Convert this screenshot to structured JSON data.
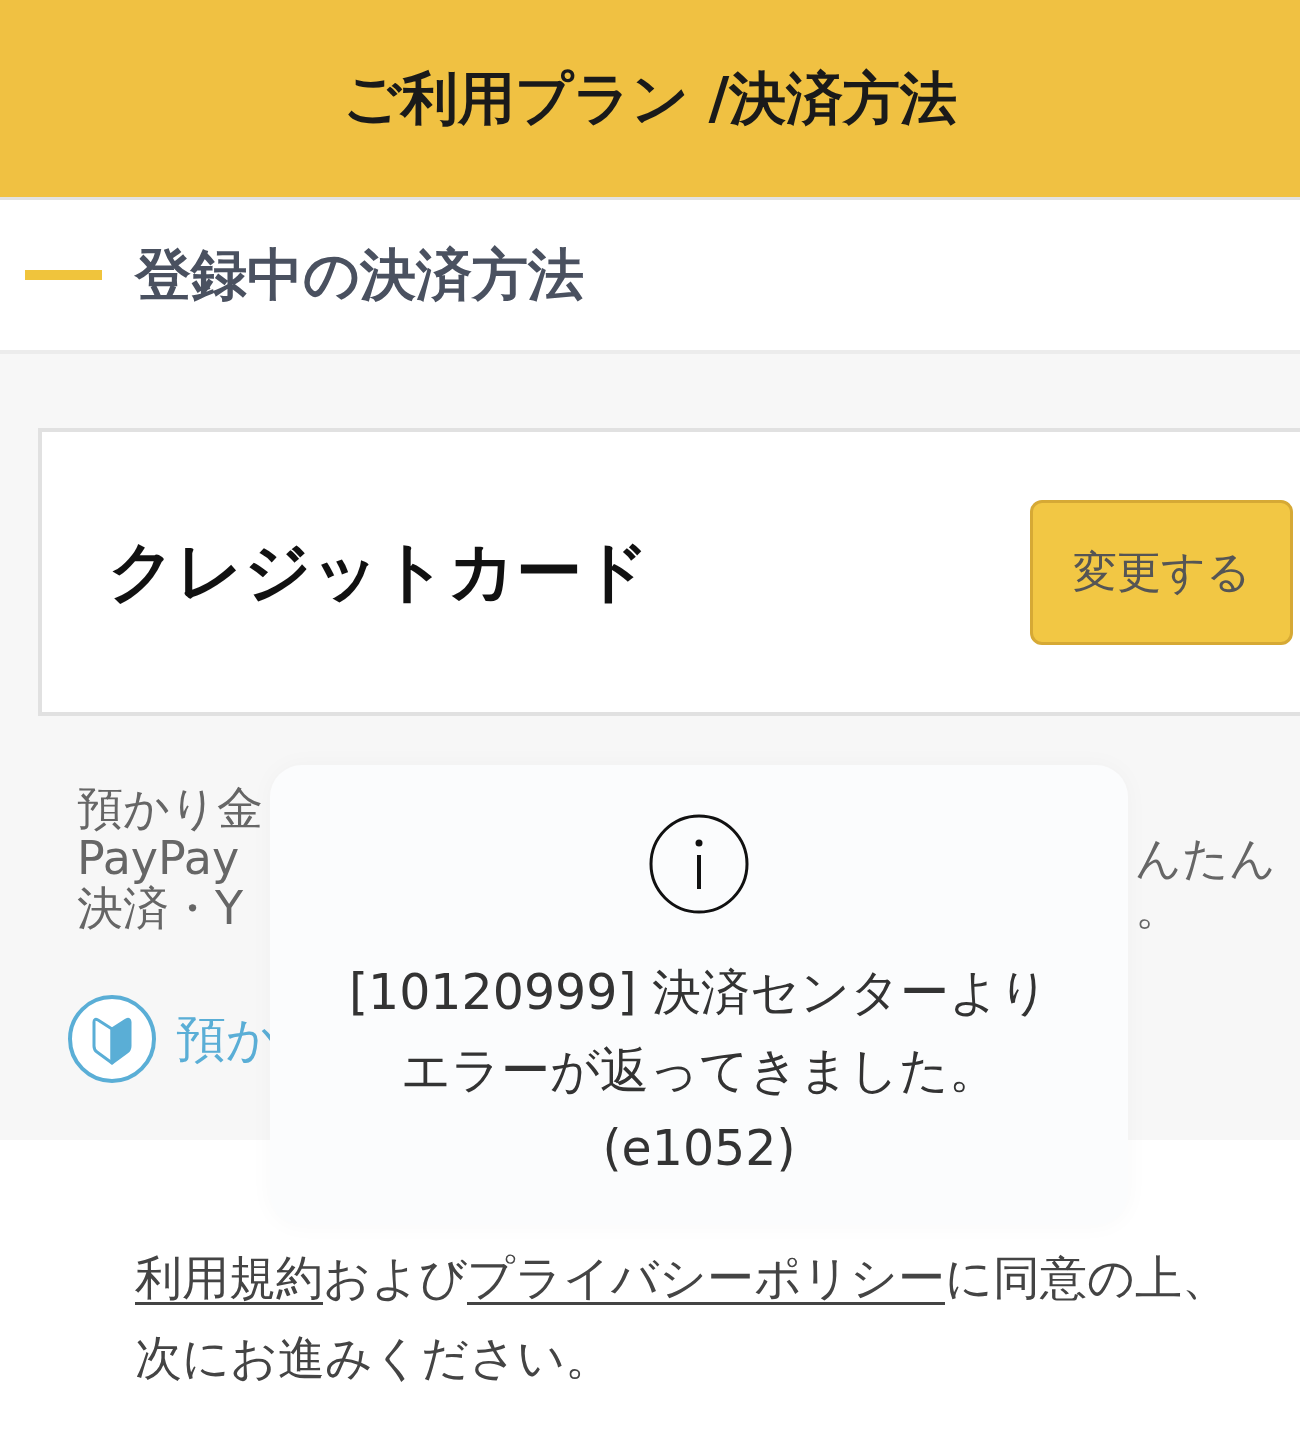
{
  "header": {
    "title": "ご利用プラン /決済方法"
  },
  "section": {
    "heading": "登録中の決済方法"
  },
  "payment_method": {
    "name": "クレジットカード",
    "button": "変更する"
  },
  "notice": {
    "lines": [
      {
        "left": "預かり金"
      },
      {
        "left": "PayPay",
        "right": "んたん"
      },
      {
        "left": "決済・Y",
        "right": "。"
      }
    ]
  },
  "help_link": {
    "label": "預か"
  },
  "toast": {
    "message": [
      "[10120999] 決済センターより",
      "エラーが返ってきました。",
      "(e1052)"
    ]
  },
  "consent": {
    "parts": [
      {
        "kind": "link",
        "text": "利用規約"
      },
      {
        "kind": "text",
        "text": "および"
      },
      {
        "kind": "link",
        "text": "プライバシーポリシー"
      },
      {
        "kind": "text",
        "text": "に同意の上、次にお進みください。"
      }
    ]
  }
}
